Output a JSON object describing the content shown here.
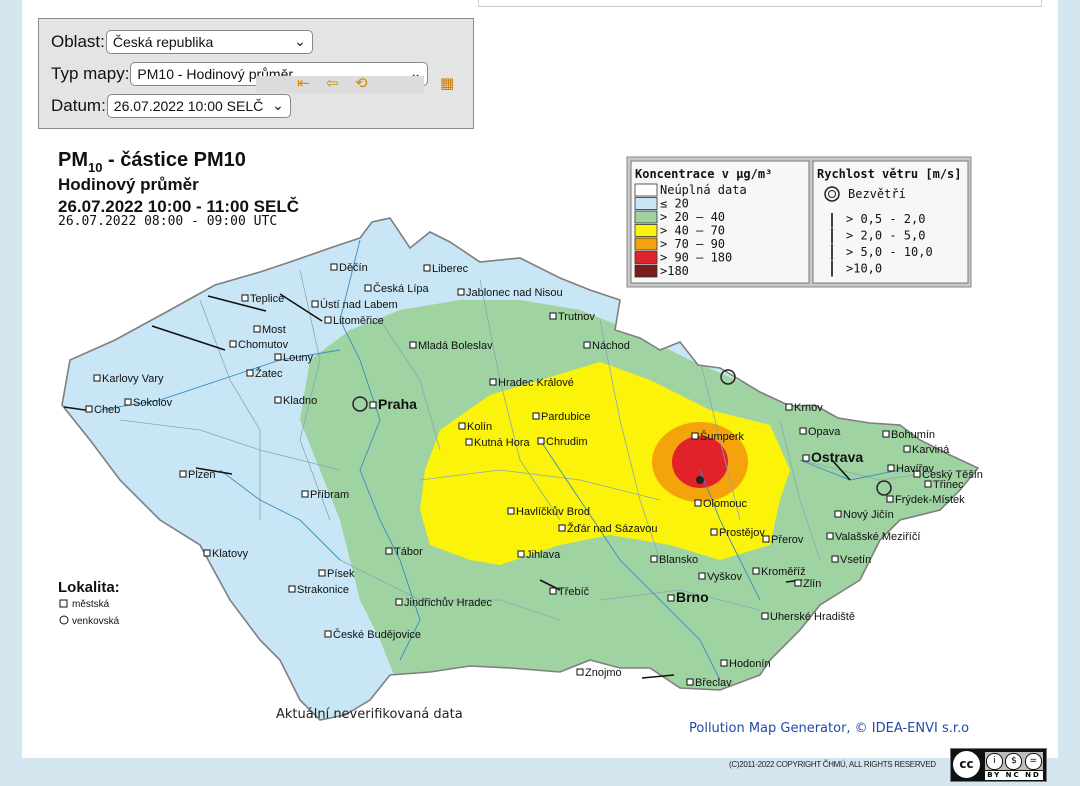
{
  "form": {
    "oblast_label": "Oblast:",
    "oblast_value": "Česká republika",
    "typ_label": "Typ mapy:",
    "typ_value": "PM10 - Hodinový průměr",
    "datum_label": "Datum:",
    "datum_value": "26.07.2022 10:00 SELČ"
  },
  "map": {
    "title_main": "PM",
    "title_sub": "10",
    "title_rest": " - částice PM10",
    "subtitle": "Hodinový průměr",
    "time_local": "26.07.2022 10:00 - 11:00 SELČ",
    "time_utc": "26.07.2022 08:00 - 09:00 UTC",
    "note": "Aktuální neverifikovaná data",
    "credit": "Pollution Map Generator, © IDEA-ENVI s.r.o",
    "legend_conc_title": "Koncentrace v μg/m³",
    "legend_conc": [
      {
        "label": "Neúplná data",
        "color": "#ffffff"
      },
      {
        "label": "     ≤  20",
        "color": "#c8e6f5"
      },
      {
        "label": "> 20  –  40",
        "color": "#9fd3a1"
      },
      {
        "label": "> 40  –  70",
        "color": "#fcf30a"
      },
      {
        "label": "> 70  –  90",
        "color": "#f4a30c"
      },
      {
        "label": "> 90  – 180",
        "color": "#e1222a"
      },
      {
        "label": ">180",
        "color": "#7a1c1c"
      }
    ],
    "legend_wind_title": "Rychlost větru [m/s]",
    "legend_wind": [
      "Bezvětří",
      "> 0,5 -   2,0",
      "> 2,0 -   5,0",
      "> 5,0 -  10,0",
      ">10,0"
    ],
    "lokalita_title": "Lokalita:",
    "lokalita_items": [
      "městská",
      "venkovská"
    ],
    "cities": [
      "Děčín",
      "Liberec",
      "Česká Lípa",
      "Teplice",
      "Ústí nad Labem",
      "Jablonec nad Nisou",
      "Most",
      "Litoměřice",
      "Trutnov",
      "Chomutov",
      "Mladá Boleslav",
      "Náchod",
      "Louny",
      "Karlovy Vary",
      "Žatec",
      "Hradec Králové",
      "Sokolov",
      "Kladno",
      "Praha",
      "Pardubice",
      "Cheb",
      "Kolín",
      "Kutná Hora",
      "Chrudim",
      "Šumperk",
      "Krnov",
      "Opava",
      "Bohumín",
      "Karviná",
      "Ostrava",
      "Havířov",
      "Český Těšín",
      "Třinec",
      "Frýdek-Místek",
      "Plzeň",
      "Příbram",
      "Havlíčkův Brod",
      "Olomouc",
      "Žďár nad Sázavou",
      "Prostějov",
      "Přerov",
      "Nový Jičín",
      "Valašské Meziříčí",
      "Klatovy",
      "Tábor",
      "Jihlava",
      "Blansko",
      "Vsetín",
      "Písek",
      "Strakonice",
      "Vyškov",
      "Kroměříž",
      "Zlín",
      "Třebíč",
      "Jindřichův Hradec",
      "Brno",
      "Uherské Hradiště",
      "České Budějovice",
      "Hodonín",
      "Znojmo",
      "Břeclav"
    ]
  },
  "footer": {
    "copyright": "(C)2011-2022 COPYRIGHT ČHMÚ, ALL RIGHTS RESERVED",
    "cc_left": "cc",
    "cc_bottom": "BY  NC  ND"
  }
}
